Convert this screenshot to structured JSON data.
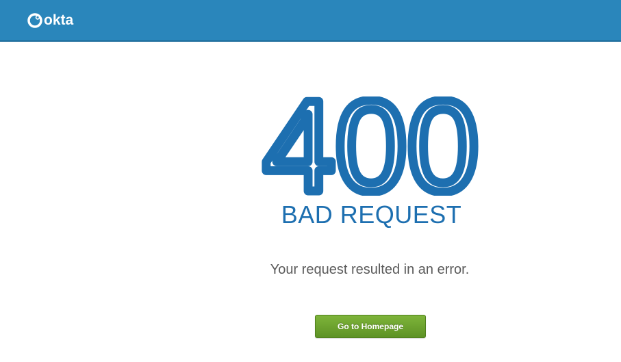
{
  "header": {
    "brand_name": "okta",
    "logo_icon": "okta-logo-icon",
    "background_color": "#2a86bb"
  },
  "error": {
    "code": "400",
    "title": "BAD REQUEST",
    "message": "Your request resulted in an error.",
    "accent_color": "#1d6fb0"
  },
  "actions": {
    "home_button_label": "Go to Homepage",
    "button_color": "#6ca42f"
  }
}
